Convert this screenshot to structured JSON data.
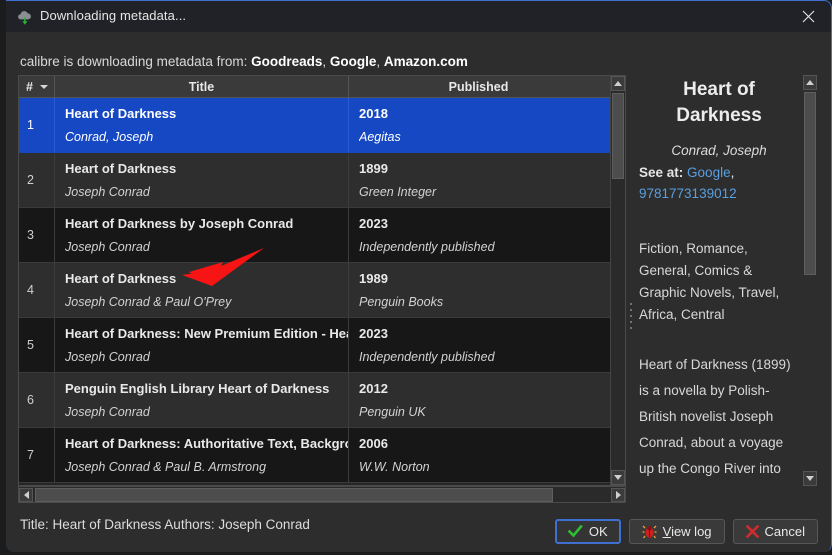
{
  "window": {
    "title": "Downloading metadata...",
    "title_icon": "cloud-download-icon",
    "close_icon": "close-icon",
    "accent_color": "#3f6fd0"
  },
  "source_line": {
    "prefix": "calibre is downloading metadata from: ",
    "sources": [
      "Goodreads",
      "Google",
      "Amazon.com"
    ],
    "separator": ", "
  },
  "table": {
    "columns": [
      {
        "key": "num",
        "label": "#",
        "sort_indicator": "chevron-down-icon"
      },
      {
        "key": "title",
        "label": "Title"
      },
      {
        "key": "published",
        "label": "Published"
      }
    ],
    "rows": [
      {
        "num": "1",
        "title": "Heart of Darkness",
        "author": "Conrad, Joseph",
        "year": "2018",
        "publisher": "Aegitas",
        "selected": true
      },
      {
        "num": "2",
        "title": "Heart of Darkness",
        "author": "Joseph Conrad",
        "year": "1899",
        "publisher": "Green Integer",
        "selected": false
      },
      {
        "num": "3",
        "title": "Heart of Darkness by Joseph Conrad",
        "author": "Joseph Conrad",
        "year": "2023",
        "publisher": "Independently published",
        "selected": false
      },
      {
        "num": "4",
        "title": "Heart of Darkness",
        "author": "Joseph Conrad & Paul O'Prey",
        "year": "1989",
        "publisher": "Penguin Books",
        "selected": false
      },
      {
        "num": "5",
        "title": "Heart of Darkness: New Premium Edition - Hea",
        "author": "Joseph Conrad",
        "year": "2023",
        "publisher": "Independently published",
        "selected": false
      },
      {
        "num": "6",
        "title": "Penguin English Library Heart of Darkness",
        "author": "Joseph Conrad",
        "year": "2012",
        "publisher": "Penguin UK",
        "selected": false
      },
      {
        "num": "7",
        "title": "Heart of Darkness: Authoritative Text, Backgro",
        "author": "Joseph Conrad & Paul B. Armstrong",
        "year": "2006",
        "publisher": "W.W. Norton",
        "selected": false
      }
    ]
  },
  "detail": {
    "title": "Heart of Darkness",
    "author": "Conrad, Joseph",
    "see_at_label": "See at:",
    "links": [
      "Google",
      "9781773139012"
    ],
    "tags": "Fiction, Romance, General, Comics & Graphic Novels, Travel, Africa, Central",
    "description": "Heart of Darkness (1899) is a novella by Polish-British novelist Joseph Conrad, about a voyage up the Congo River into the Congo Free State, in the heart of Africa, by the"
  },
  "status": {
    "text": "Title: Heart of Darkness Authors: Joseph Conrad"
  },
  "buttons": [
    {
      "name": "ok-button",
      "label": "OK",
      "icon": "check-icon",
      "focused": true
    },
    {
      "name": "view-log-button",
      "label_prefix": "",
      "label_underlined": "V",
      "label_rest": "iew log",
      "icon": "bug-icon",
      "focused": false
    },
    {
      "name": "cancel-button",
      "label": "Cancel",
      "icon": "x-icon",
      "focused": false
    }
  ],
  "annotation": {
    "arrow_color": "#f71414",
    "points_to": "row-4-title"
  }
}
